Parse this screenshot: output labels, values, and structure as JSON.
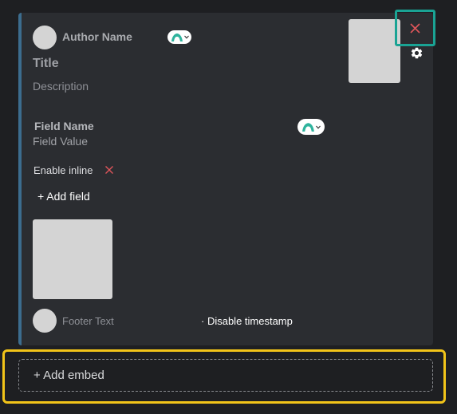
{
  "embed": {
    "author_name": "Author Name",
    "title": "Title",
    "description": "Description",
    "field": {
      "name": "Field Name",
      "value": "Field Value"
    },
    "enable_inline_label": "Enable inline",
    "add_field_label": "+ Add field",
    "footer_text": "Footer Text",
    "disable_timestamp_label": "· Disable timestamp",
    "accent_color": "#3c6d8f"
  },
  "add_embed_label": "+ Add embed",
  "icons": {
    "close": "close-icon",
    "settings": "gear-icon",
    "emoji": "emoji-picker-icon",
    "remove_inline": "close-icon"
  },
  "colors": {
    "close_highlight": "#1aa394",
    "add_embed_highlight": "#f2c419",
    "danger": "#e0555a"
  }
}
